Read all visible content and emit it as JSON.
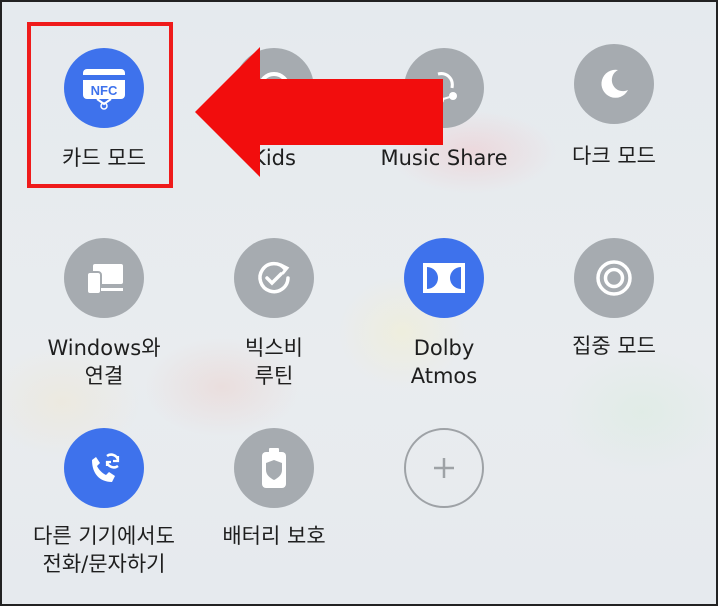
{
  "tiles": [
    {
      "id": "card-mode",
      "icon": "nfc-card-icon",
      "state": "on",
      "label": [
        "카드 모드"
      ]
    },
    {
      "id": "kids",
      "icon": "kids-icon",
      "state": "off",
      "label": [
        "Kids"
      ]
    },
    {
      "id": "music-share",
      "icon": "music-share-icon",
      "state": "off",
      "label": [
        "Music Share"
      ]
    },
    {
      "id": "dark-mode",
      "icon": "moon-icon",
      "state": "off",
      "label": [
        "다크 모드"
      ]
    },
    {
      "id": "link-to-windows",
      "icon": "windows-link-icon",
      "state": "off",
      "label": [
        "Windows와",
        "연결"
      ]
    },
    {
      "id": "bixby-routines",
      "icon": "bixby-routines-icon",
      "state": "off",
      "label": [
        "빅스비",
        "루틴"
      ]
    },
    {
      "id": "dolby-atmos",
      "icon": "dolby-icon",
      "state": "on",
      "label": [
        "Dolby",
        "Atmos"
      ]
    },
    {
      "id": "focus-mode",
      "icon": "focus-target-icon",
      "state": "off",
      "label": [
        "집중 모드"
      ]
    },
    {
      "id": "call-other-devices",
      "icon": "call-sync-icon",
      "state": "on",
      "label": [
        "다른 기기에서도",
        "전화/문자하기"
      ]
    },
    {
      "id": "battery-protect",
      "icon": "battery-shield-icon",
      "state": "off",
      "label": [
        "배터리 보호"
      ]
    },
    {
      "id": "add-tile",
      "icon": "plus-icon",
      "state": "add",
      "label": []
    }
  ],
  "nfc_icon_text": "NFC",
  "colors": {
    "on": "#3e72ec",
    "off": "#a6abb0",
    "highlight": "#ef1b1b",
    "arrow": "#f20d0d"
  }
}
